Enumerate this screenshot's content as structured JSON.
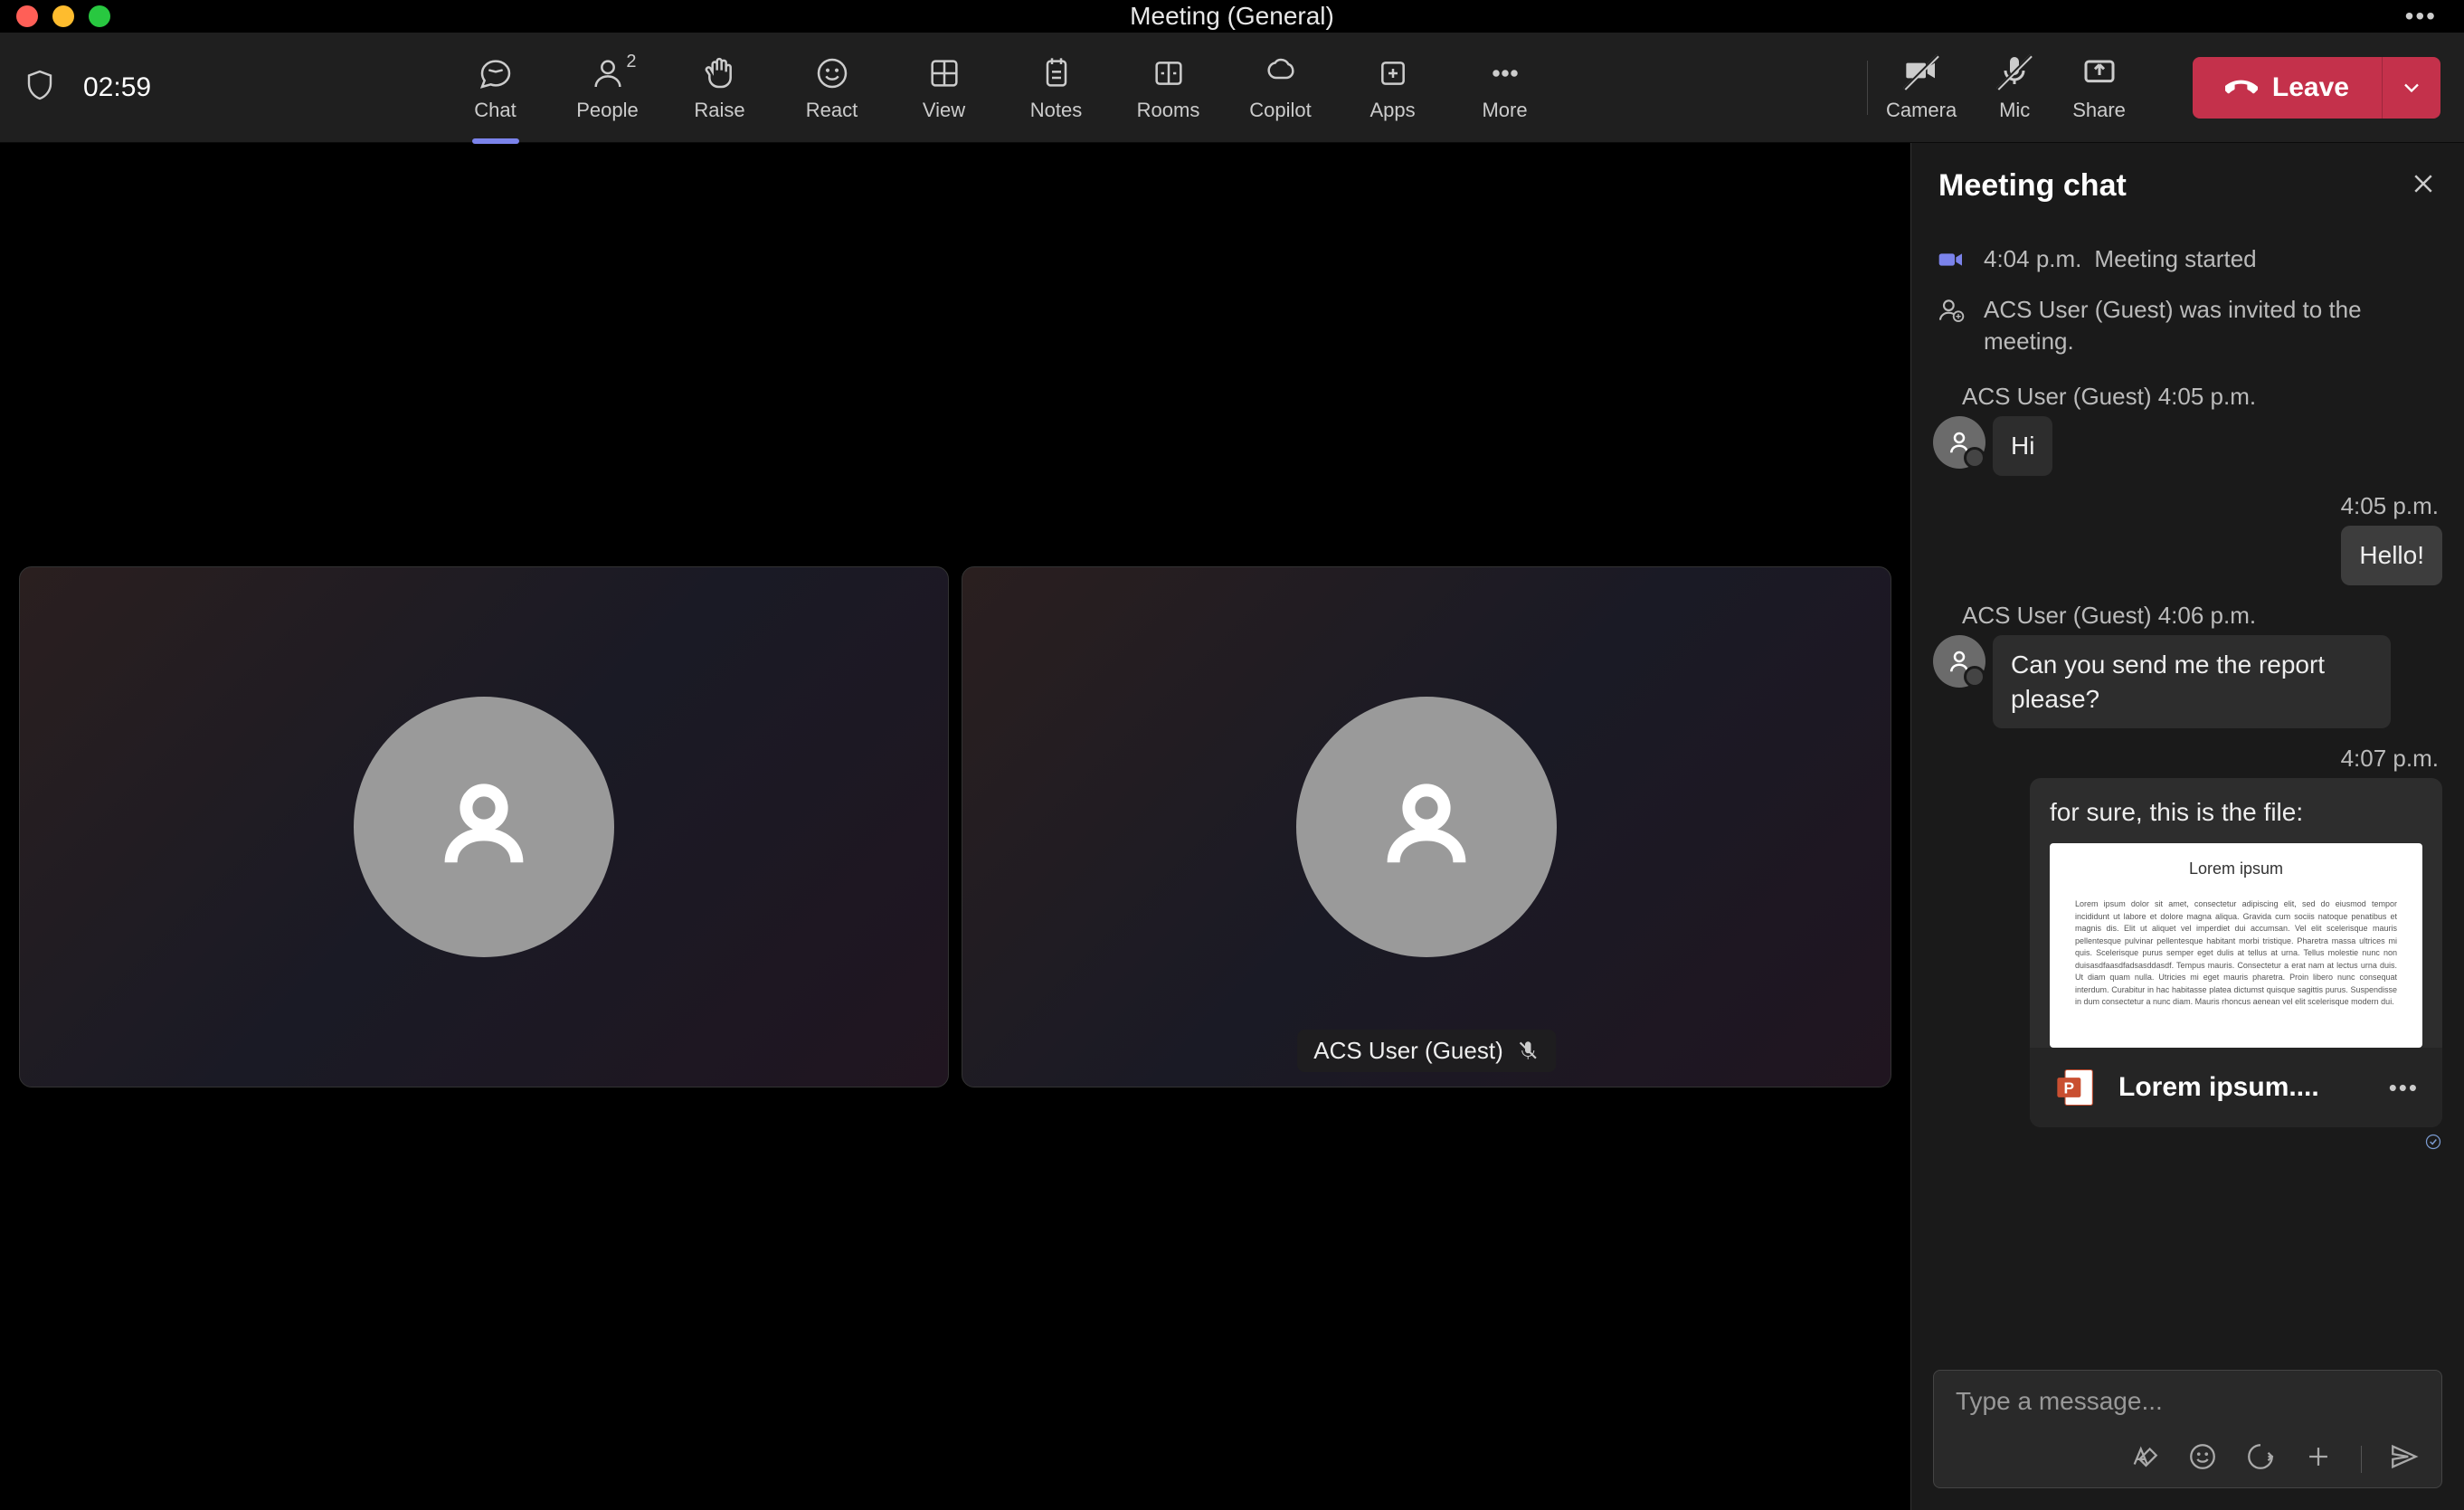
{
  "window": {
    "title": "Meeting (General)"
  },
  "toolbar": {
    "timer": "02:59",
    "chat": "Chat",
    "people": "People",
    "people_count": "2",
    "raise": "Raise",
    "react": "React",
    "view": "View",
    "notes": "Notes",
    "rooms": "Rooms",
    "copilot": "Copilot",
    "apps": "Apps",
    "more": "More",
    "camera": "Camera",
    "mic": "Mic",
    "share": "Share",
    "leave": "Leave"
  },
  "stage": {
    "tile2_label": "ACS User (Guest)"
  },
  "chat": {
    "title": "Meeting chat",
    "started_time": "4:04 p.m.",
    "started_text": "Meeting started",
    "invited_text": "ACS User (Guest) was invited to the meeting.",
    "msg1_meta": "ACS User (Guest)   4:05 p.m.",
    "msg1_text": "Hi",
    "msg2_time": "4:05 p.m.",
    "msg2_text": "Hello!",
    "msg3_meta": "ACS User (Guest)   4:06 p.m.",
    "msg3_text": "Can you send me the report please?",
    "msg4_time": "4:07 p.m.",
    "msg4_caption": "for sure, this is the file:",
    "file_preview_title": "Lorem ipsum",
    "file_preview_body": "Lorem ipsum dolor sit amet, consectetur adipiscing elit, sed do eiusmod tempor incididunt ut labore et dolore magna aliqua. Gravida cum sociis natoque penatibus et magnis dis. Elit ut aliquet vel imperdiet dui accumsan. Vel elit scelerisque mauris pellentesque pulvinar pellentesque habitant morbi tristique. Pharetra massa ultrices mi quis. Scelerisque purus semper eget dulis at tellus at urna. Tellus molestie nunc non duisasdfaasdfadsasddasdf. Tempus mauris. Consectetur a erat nam at lectus urna duis. Ut diam quam nulla. Utricies mi eget mauris pharetra. Proin libero nunc consequat interdum. Curabitur in hac habitasse platea dictumst quisque sagittis purus. Suspendisse in dum consectetur a nunc diam. Mauris rhoncus aenean vel elit scelerisque modern dui.",
    "file_name": "Lorem ipsum....",
    "compose_placeholder": "Type a message..."
  }
}
